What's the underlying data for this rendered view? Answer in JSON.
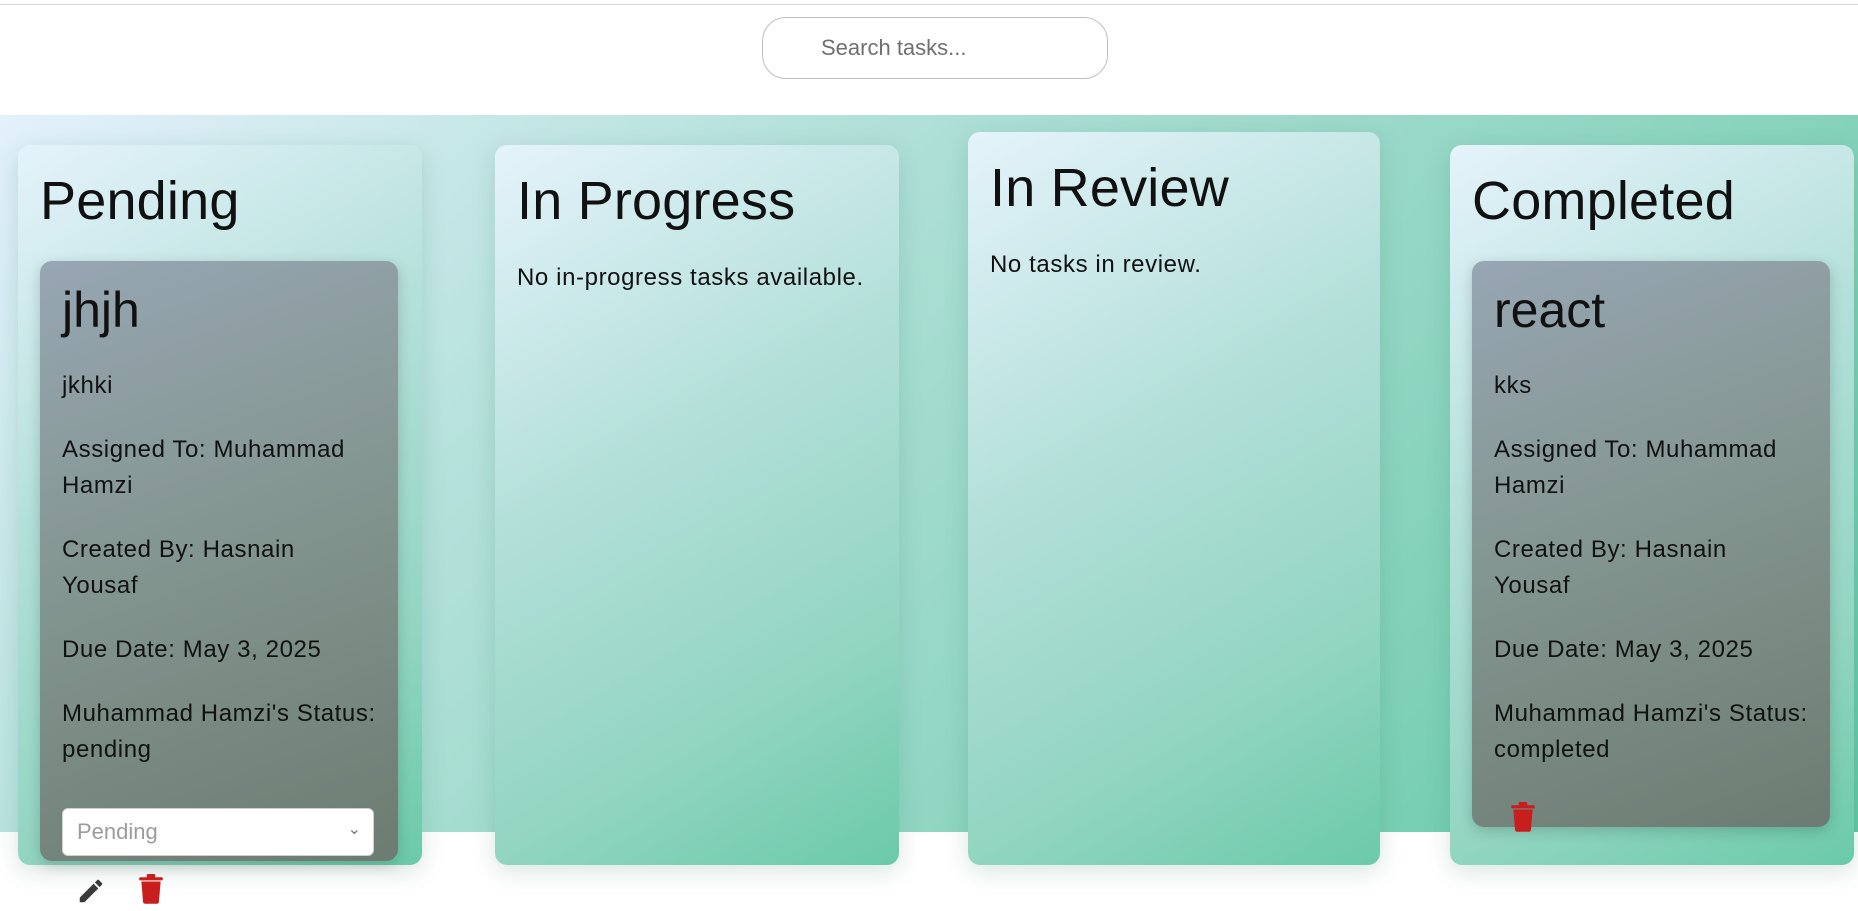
{
  "search": {
    "placeholder": "Search tasks..."
  },
  "columns": {
    "pending": {
      "title": "Pending",
      "card": {
        "title": "jhjh",
        "description": "jkhki",
        "assigned_to": "Assigned To: Muhammad Hamzi",
        "created_by": "Created By: Hasnain Yousaf",
        "due_date": "Due Date: May 3, 2025",
        "status": "Muhammad Hamzi's Status: pending",
        "status_select_value": "Pending",
        "edit_icon": "pencil-icon",
        "delete_icon": "trash-icon"
      }
    },
    "in_progress": {
      "title": "In Progress",
      "empty_text": "No in-progress tasks available."
    },
    "in_review": {
      "title": "In Review",
      "empty_text": "No tasks in review."
    },
    "completed": {
      "title": "Completed",
      "card": {
        "title": "react",
        "description": "kks",
        "assigned_to": "Assigned To: Muhammad Hamzi",
        "created_by": "Created By: Hasnain Yousaf",
        "due_date": "Due Date: May 3, 2025",
        "status": "Muhammad Hamzi's Status: completed",
        "delete_icon": "trash-icon"
      }
    }
  },
  "colors": {
    "delete_red": "#c81e1e",
    "board_start": "#e3f1fb",
    "board_end": "#62c8a6",
    "card_start": "#97a6b3",
    "card_end": "#6c7c72"
  }
}
